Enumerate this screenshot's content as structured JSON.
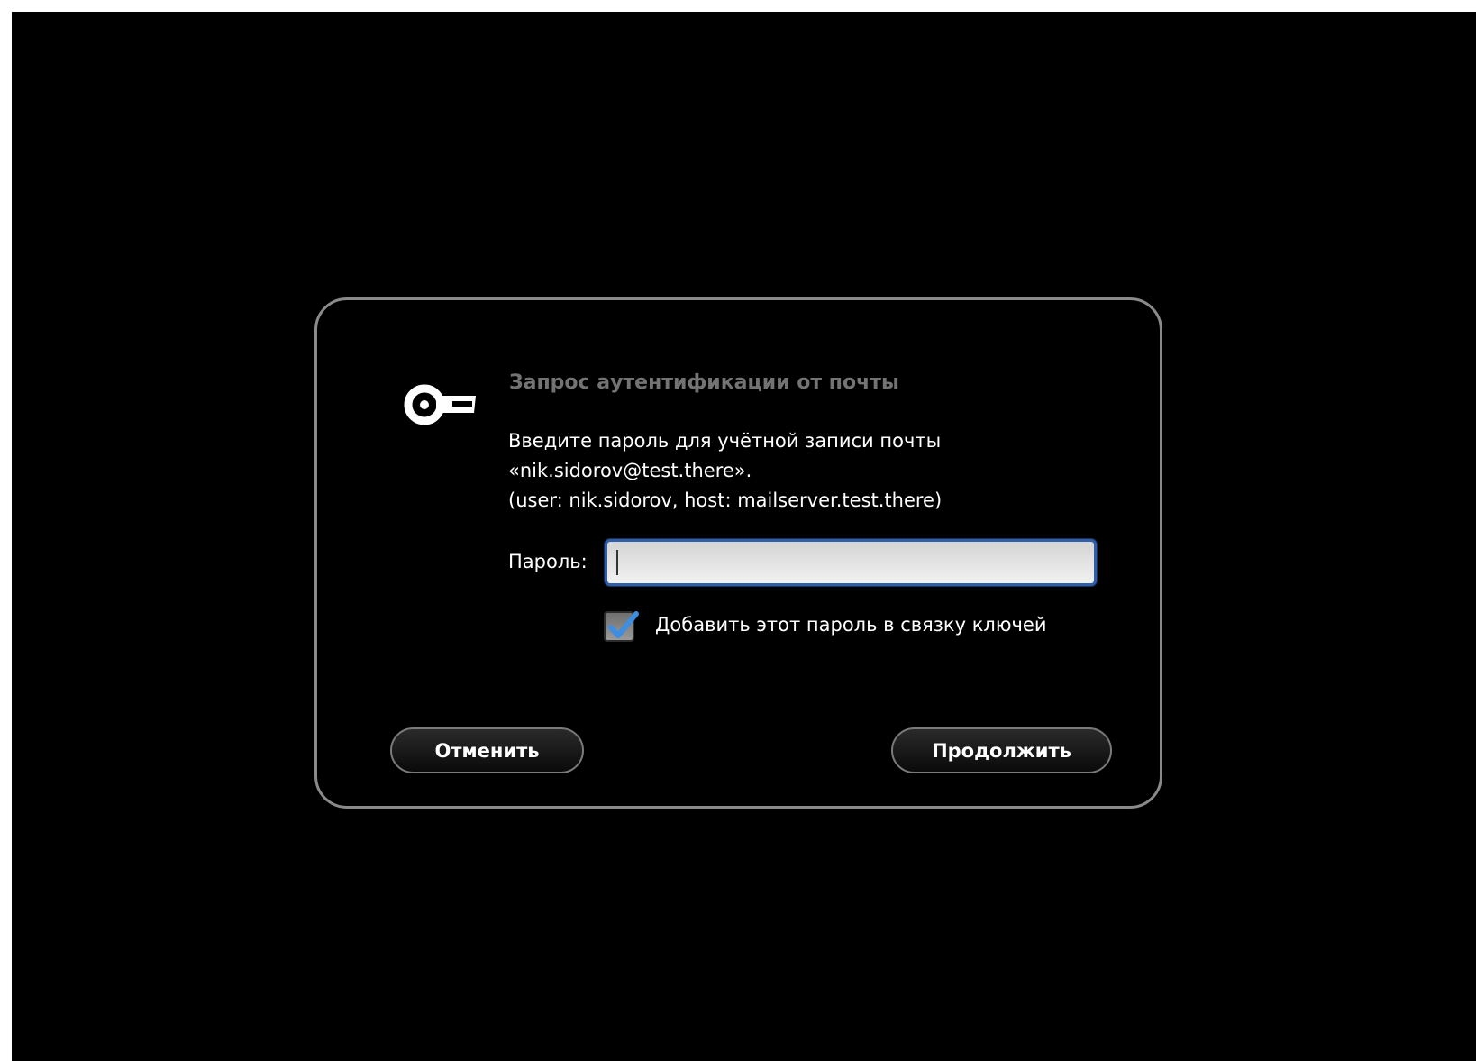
{
  "dialog": {
    "icon": "key-icon",
    "title": "Запрос аутентификации от почты",
    "message_lines": [
      "Введите пароль для учётной записи почты",
      "«nik.sidorov@test.there».",
      "(user: nik.sidorov, host: mailserver.test.there)"
    ],
    "password_label": "Пароль:",
    "password_value": "",
    "remember_checkbox": {
      "label": "Добавить этот пароль в связку ключей",
      "checked": true
    },
    "buttons": {
      "cancel": "Отменить",
      "continue": "Продолжить"
    }
  },
  "colors": {
    "background": "#000000",
    "dialog_border": "#8a8a8a",
    "title_text": "#737373",
    "focus_ring": "#2e5fa8",
    "check_mark": "#3d8ee0"
  }
}
